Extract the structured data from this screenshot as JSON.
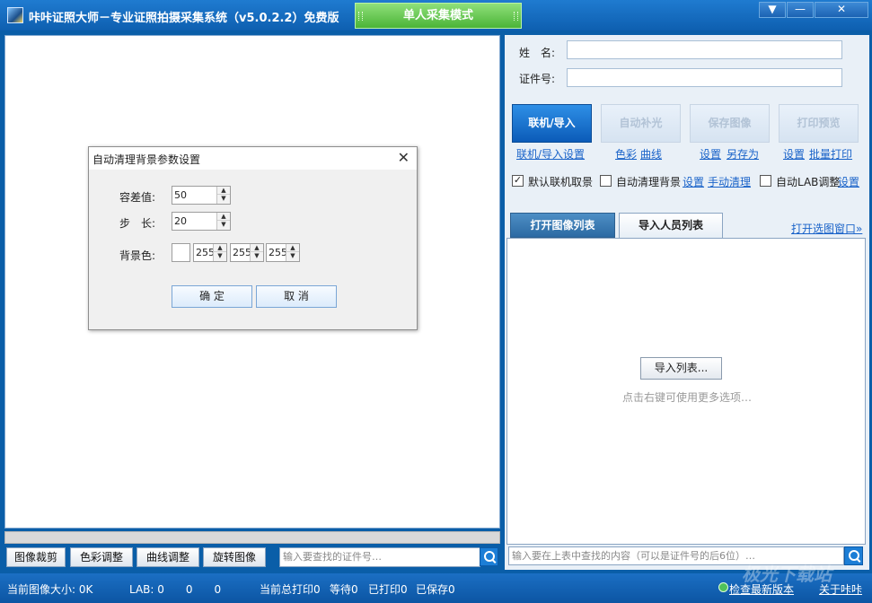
{
  "window": {
    "title": "咔咔证照大师－专业证照拍摄采集系统（v5.0.2.2）免费版",
    "mode_tab": "单人采集模式",
    "menu_glyph": "▼",
    "minimize_glyph": "—",
    "close_glyph": "✕"
  },
  "toolbar": {
    "crop": "图像裁剪",
    "color": "色彩调整",
    "curve": "曲线调整",
    "rotate": "旋转图像",
    "search_placeholder": "输入要查找的证件号…"
  },
  "form": {
    "name_label": "姓　名:",
    "id_label": "证件号:"
  },
  "actions": {
    "connect": "联机/导入",
    "auto_light": "自动补光",
    "save_image": "保存图像",
    "print_preview": "打印预览",
    "connect_settings": "联机/导入设置",
    "color_link": "色彩",
    "curve_link": "曲线",
    "settings_link": "设置",
    "save_as_link": "另存为",
    "print_settings_link": "设置",
    "batch_print_link": "批量打印"
  },
  "options": {
    "default_connect": {
      "label": "默认联机取景",
      "checked": true
    },
    "auto_clean": {
      "label": "自动清理背景",
      "checked": false
    },
    "auto_clean_settings": "设置",
    "manual_clean": "手动清理",
    "auto_lab": {
      "label": "自动LAB调整",
      "checked": false
    },
    "auto_lab_settings": "设置"
  },
  "tabs": {
    "open_list": "打开图像列表",
    "import_list": "导入人员列表",
    "open_selector": "打开选图窗口»"
  },
  "list": {
    "import_button": "导入列表...",
    "hint": "点击右键可使用更多选项…",
    "search_placeholder": "输入要在上表中查找的内容（可以是证件号的后6位）…"
  },
  "status": {
    "image_size": "当前图像大小: 0K",
    "lab": "LAB: 0　　0　　0",
    "total_print": "当前总打印0",
    "waiting": "等待0",
    "printed": "已打印0",
    "saved": "已保存0",
    "check_update": "检查最新版本",
    "about": "关于咔咔"
  },
  "watermark": "极光下载站",
  "dialog": {
    "title": "自动清理背景参数设置",
    "close_glyph": "✕",
    "tolerance_label": "容差值:",
    "tolerance_value": "50",
    "step_label": "步　长:",
    "step_value": "20",
    "bg_label": "背景色:",
    "bg_r": "255",
    "bg_g": "255",
    "bg_b": "255",
    "ok": "确 定",
    "cancel": "取 消"
  },
  "colors": {
    "titlebar": "#0e5fb0",
    "mode_tab": "#4bb437",
    "primary_button": "#0b5bb8",
    "link": "#1a63c9",
    "statusbar": "#0c55a3"
  }
}
